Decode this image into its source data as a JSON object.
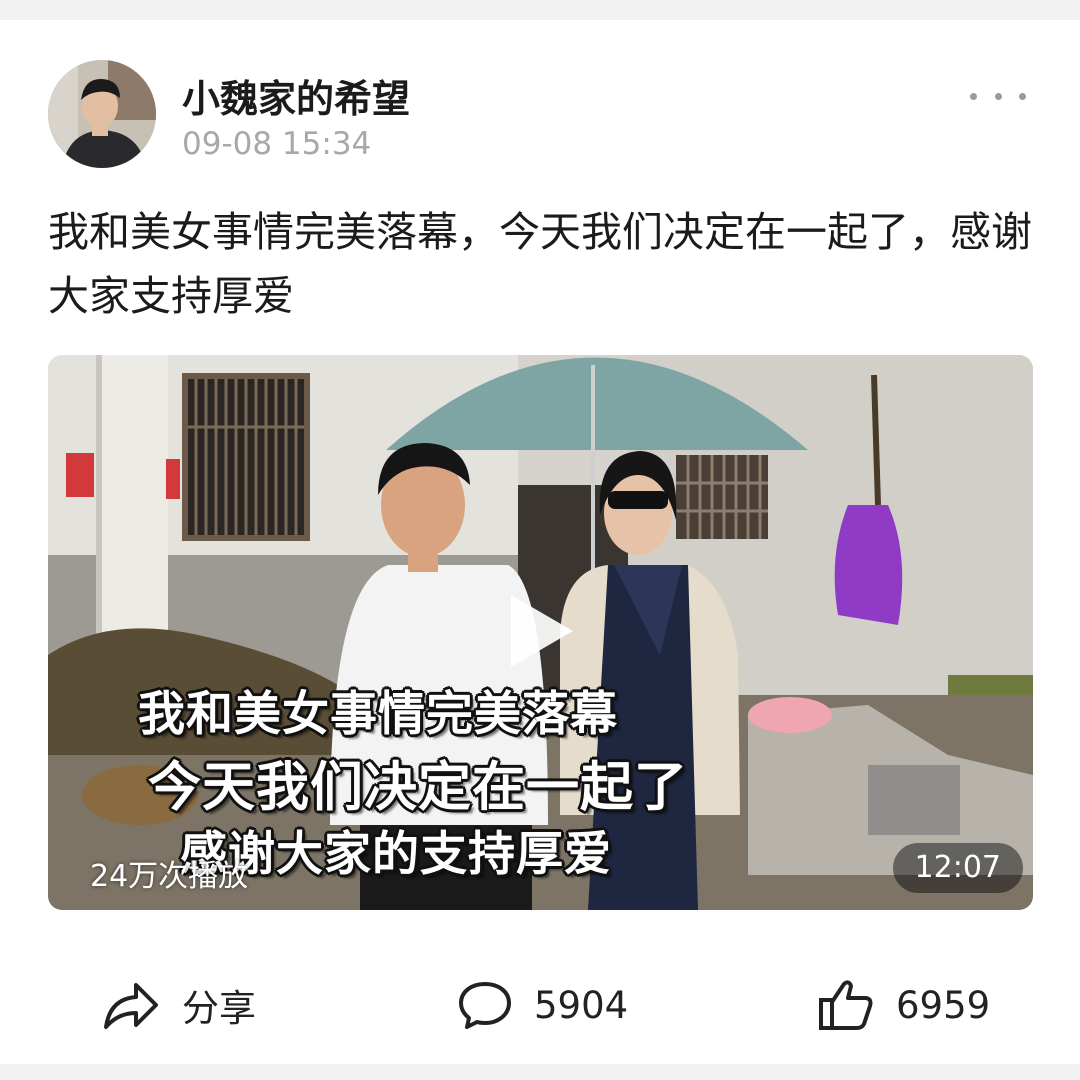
{
  "post": {
    "username": "小魏家的希望",
    "time": "09-08 15:34",
    "caption": "我和美女事情完美落幕，今天我们决定在一起了，感谢大家支持厚爱"
  },
  "video": {
    "subtitles": [
      "我和美女事情完美落幕",
      "今天我们决定在一起了",
      "感谢大家的支持厚爱"
    ],
    "views": "24万次播放",
    "duration": "12:07"
  },
  "actions": {
    "share_label": "分享",
    "comment_count": "5904",
    "like_count": "6959"
  },
  "icons": {
    "more": "more-dots-icon",
    "share": "share-arrow-icon",
    "comment": "comment-bubble-icon",
    "like": "thumbs-up-icon",
    "play": "play-icon"
  }
}
